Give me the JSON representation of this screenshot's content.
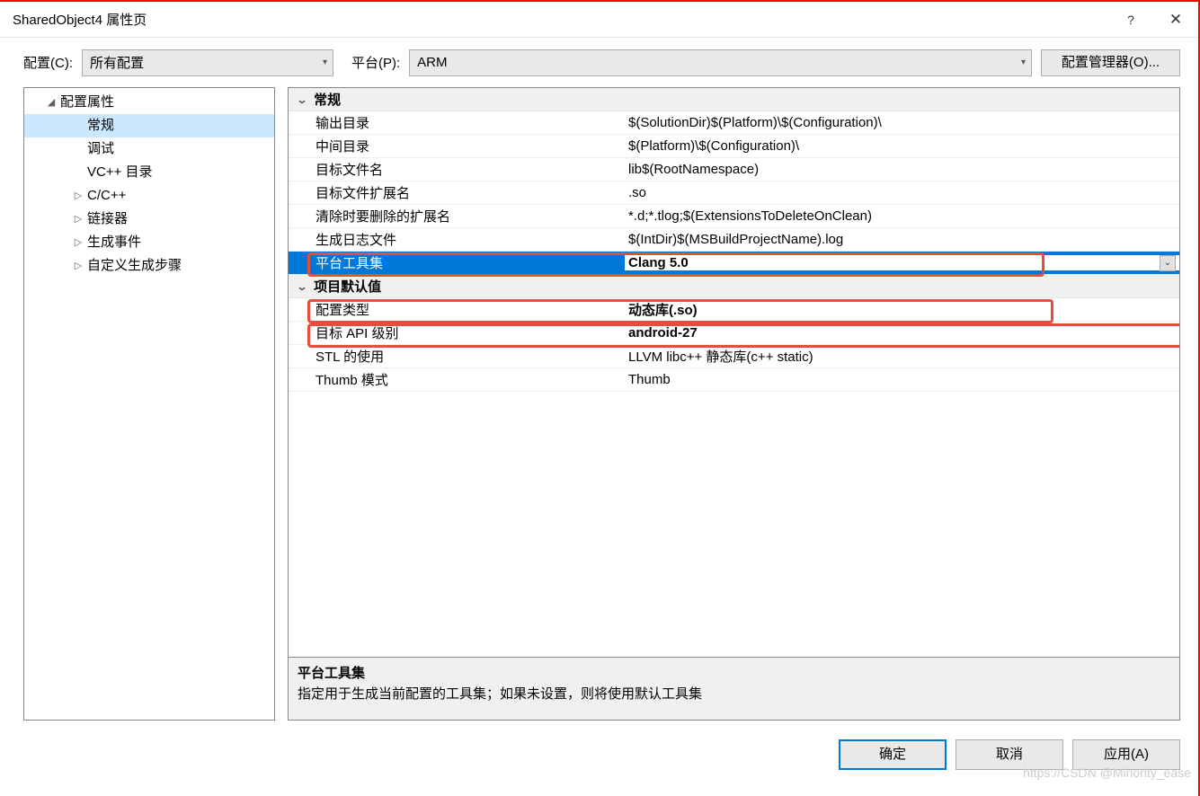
{
  "title": "SharedObject4 属性页",
  "topbar": {
    "config_label": "配置(C):",
    "config_value": "所有配置",
    "platform_label": "平台(P):",
    "platform_value": "ARM",
    "manager_button": "配置管理器(O)..."
  },
  "tree": {
    "root": "配置属性",
    "items": [
      "常规",
      "调试",
      "VC++ 目录",
      "C/C++",
      "链接器",
      "生成事件",
      "自定义生成步骤"
    ],
    "expandable": [
      false,
      false,
      false,
      true,
      true,
      true,
      true
    ],
    "selected_index": 0
  },
  "groups": [
    {
      "title": "常规",
      "rows": [
        {
          "name": "输出目录",
          "value": "$(SolutionDir)$(Platform)\\$(Configuration)\\",
          "bold": false
        },
        {
          "name": "中间目录",
          "value": "$(Platform)\\$(Configuration)\\",
          "bold": false
        },
        {
          "name": "目标文件名",
          "value": "lib$(RootNamespace)",
          "bold": false
        },
        {
          "name": "目标文件扩展名",
          "value": ".so",
          "bold": false
        },
        {
          "name": "清除时要删除的扩展名",
          "value": "*.d;*.tlog;$(ExtensionsToDeleteOnClean)",
          "bold": false
        },
        {
          "name": "生成日志文件",
          "value": "$(IntDir)$(MSBuildProjectName).log",
          "bold": false
        },
        {
          "name": "平台工具集",
          "value": "Clang 5.0",
          "bold": true,
          "selected": true,
          "dropdown": true
        }
      ]
    },
    {
      "title": "项目默认值",
      "rows": [
        {
          "name": "配置类型",
          "value": "动态库(.so)",
          "bold": true
        },
        {
          "name": "目标 API 级别",
          "value": "android-27",
          "bold": true
        },
        {
          "name": "STL 的使用",
          "value": "LLVM libc++ 静态库(c++ static)",
          "bold": false
        },
        {
          "name": "Thumb 模式",
          "value": "Thumb",
          "bold": false
        }
      ]
    }
  ],
  "description": {
    "title": "平台工具集",
    "text": "指定用于生成当前配置的工具集；如果未设置，则将使用默认工具集"
  },
  "buttons": {
    "ok": "确定",
    "cancel": "取消",
    "apply": "应用(A)"
  },
  "watermark": "https://CSDN @Minority_ease"
}
